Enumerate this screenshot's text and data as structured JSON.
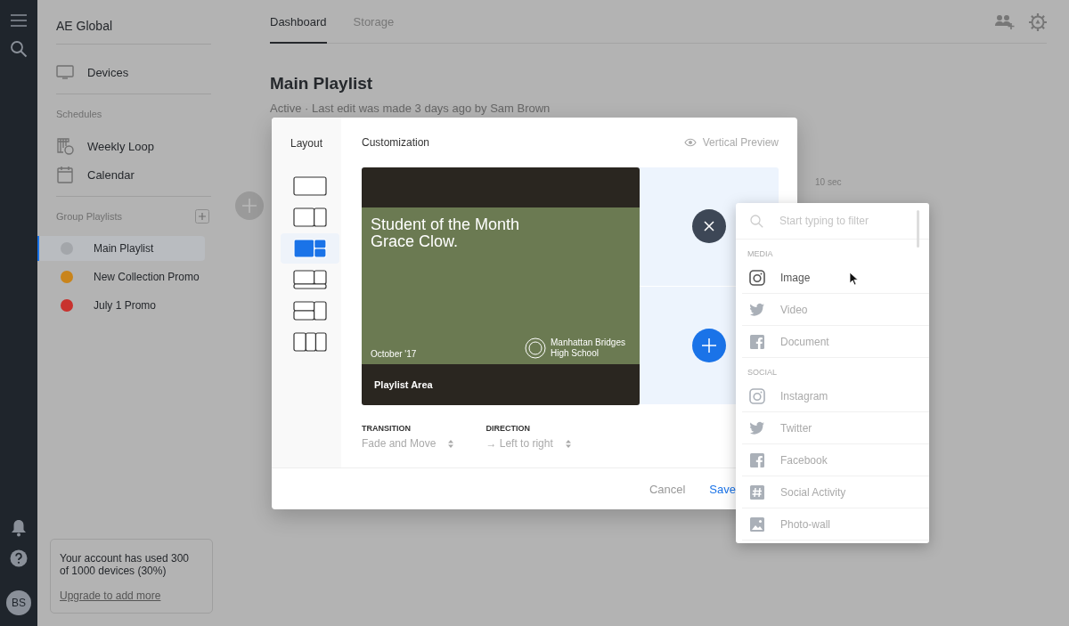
{
  "rail": {
    "avatar": "BS"
  },
  "sidebar": {
    "org": "AE Global",
    "devices": "Devices",
    "schedules_heading": "Schedules",
    "schedules": [
      {
        "label": "Weekly Loop",
        "kind": "loop"
      },
      {
        "label": "Calendar",
        "kind": "calendar"
      }
    ],
    "group_heading": "Group Playlists",
    "playlists": [
      {
        "label": "Main Playlist",
        "color": "#a3a6aa",
        "selected": true
      },
      {
        "label": "New Collection Promo",
        "color": "#c9841b",
        "selected": false
      },
      {
        "label": "July 1 Promo",
        "color": "#c8322e",
        "selected": false
      }
    ],
    "usage": {
      "text": "Your account has used 300 of 1000 devices (30%)",
      "link": "Upgrade to add more"
    }
  },
  "tabs": [
    {
      "label": "Dashboard",
      "selected": true
    },
    {
      "label": "Storage",
      "selected": false
    }
  ],
  "playlist": {
    "title": "Main Playlist",
    "subtitle": "Active · Last edit was made 3 days ago by Sam Brown",
    "duration": "10 sec"
  },
  "modal": {
    "layout_heading": "Layout",
    "layouts": [
      {
        "kind": "single",
        "selected": false
      },
      {
        "kind": "split",
        "selected": false
      },
      {
        "kind": "main-two",
        "selected": true
      },
      {
        "kind": "split-footer",
        "selected": false
      },
      {
        "kind": "main-two-footer",
        "selected": false
      },
      {
        "kind": "three",
        "selected": false
      }
    ],
    "customization_heading": "Customization",
    "preview_toggle": "Vertical Preview",
    "slide": {
      "headline": "Student of the Month Grace Clow.",
      "date": "October '17",
      "school": "Manhattan Bridges High School"
    },
    "area_label": "Playlist Area",
    "transition": {
      "label": "TRANSITION",
      "value": "Fade and Move"
    },
    "direction": {
      "label": "DIRECTION",
      "value": "→ Left to right"
    },
    "cancel": "Cancel",
    "save": "Save"
  },
  "picker": {
    "placeholder": "Start typing to filter",
    "groups": [
      {
        "heading": "MEDIA",
        "items": [
          {
            "label": "Image",
            "kind": "camera",
            "highlighted": true
          },
          {
            "label": "Video",
            "kind": "bird",
            "highlighted": false
          },
          {
            "label": "Document",
            "kind": "letter-f",
            "highlighted": false
          }
        ]
      },
      {
        "heading": "SOCIAL",
        "items": [
          {
            "label": "Instagram",
            "kind": "camera",
            "highlighted": false
          },
          {
            "label": "Twitter",
            "kind": "bird",
            "highlighted": false
          },
          {
            "label": "Facebook",
            "kind": "letter-f",
            "highlighted": false
          },
          {
            "label": "Social Activity",
            "kind": "hash",
            "highlighted": false
          },
          {
            "label": "Photo-wall",
            "kind": "picture",
            "highlighted": false
          }
        ]
      }
    ]
  }
}
